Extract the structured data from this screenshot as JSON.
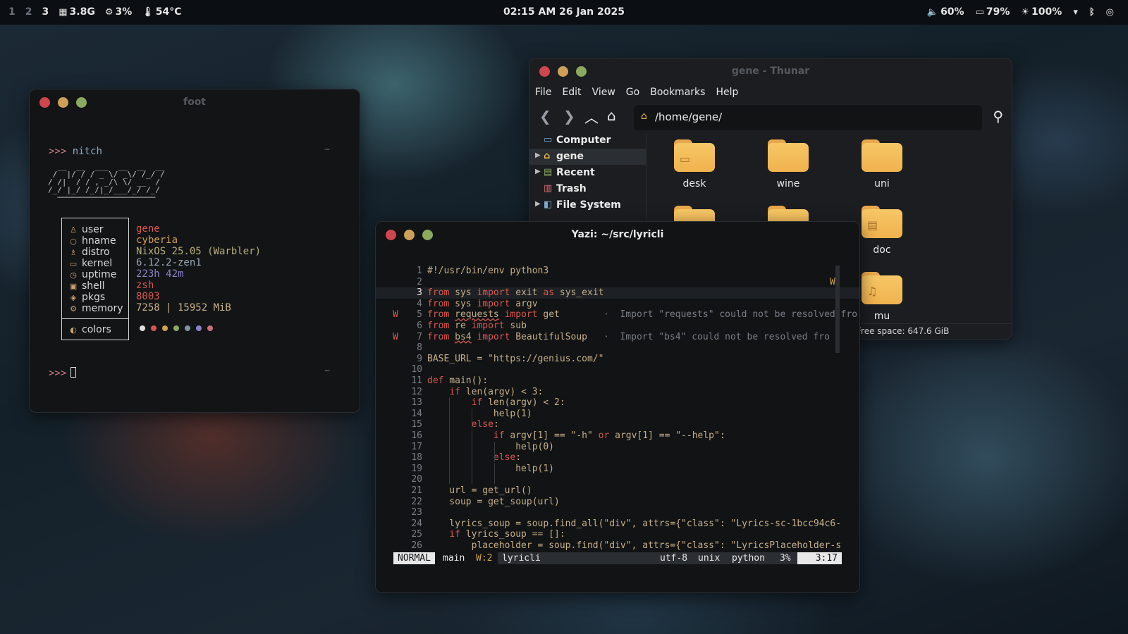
{
  "topbar": {
    "workspaces": [
      "1",
      "2",
      "3"
    ],
    "active_workspace": "3",
    "memory": "3.8G",
    "cpu": "3%",
    "temp": "54°C",
    "clock": "02:15 AM 26 Jan 2025",
    "volume": "60%",
    "battery": "79%",
    "brightness": "100%"
  },
  "foot": {
    "title": "foot",
    "prompt": ">>>",
    "command": "nitch",
    "tilde": "~",
    "info_labels": [
      "user",
      "hname",
      "distro",
      "kernel",
      "uptime",
      "shell",
      "pkgs",
      "memory"
    ],
    "info_values": [
      "gene",
      "cyberia",
      "NixOS 25.05 (Warbler)",
      "6.12.2-zen1",
      "223h 42m",
      "zsh",
      "8003",
      "7258 | 15952 MiB"
    ],
    "colors_label": "colors",
    "swatch_colors": [
      "#e0e0e0",
      "#d9574f",
      "#d4a054",
      "#8caa5e",
      "#7e93a8",
      "#8b82c8",
      "#c86f7f"
    ],
    "value_colors": [
      "#d9574f",
      "#d4a054",
      "#b7b07a",
      "#9aa8b6",
      "#8b82c8",
      "#d9574f",
      "#d9574f",
      "#c8b089"
    ]
  },
  "thunar": {
    "title": "gene - Thunar",
    "menu": [
      "File",
      "Edit",
      "View",
      "Go",
      "Bookmarks",
      "Help"
    ],
    "path": "/home/gene/",
    "sidebar": [
      "Computer",
      "gene",
      "Recent",
      "Trash",
      "File System"
    ],
    "files": [
      "desk",
      "wine",
      "uni",
      "doc",
      "mu"
    ],
    "status": "Free space: 647.6 GiB"
  },
  "yazi": {
    "title": "Yazi: ~/src/lyricli",
    "lines": [
      "#!/usr/bin/env python3",
      "",
      "from sys import exit as sys_exit",
      "from sys import argv",
      "from requests import get",
      "from re import sub",
      "from bs4 import BeautifulSoup",
      "",
      "BASE_URL = \"https://genius.com/\"",
      "",
      "def main():",
      "    if len(argv) < 3:",
      "        if len(argv) < 2:",
      "            help(1)",
      "        else:",
      "            if argv[1] == \"-h\" or argv[1] == \"--help\":",
      "                help(0)",
      "            else:",
      "                help(1)",
      "",
      "    url = get_url()",
      "    soup = get_soup(url)",
      "",
      "    lyrics_soup = soup.find_all(\"div\", attrs={\"class\": \"Lyrics-sc-1bcc94c6-",
      "    if lyrics_soup == []:",
      "        placeholder = soup.find(\"div\", attrs={\"class\": \"LyricsPlaceholder-s"
    ],
    "diagnostics": {
      "requests": "Import \"requests\" could not be resolved fro",
      "bs4": "Import \"bs4\" could not be resolved fro"
    },
    "sign": "W",
    "status": {
      "mode": "NORMAL",
      "branch": "main",
      "warnings": "W:2",
      "file": "lyricli",
      "encoding": "utf-8",
      "format": "unix",
      "filetype": "python",
      "percent": "3%",
      "position": "3:17"
    }
  }
}
